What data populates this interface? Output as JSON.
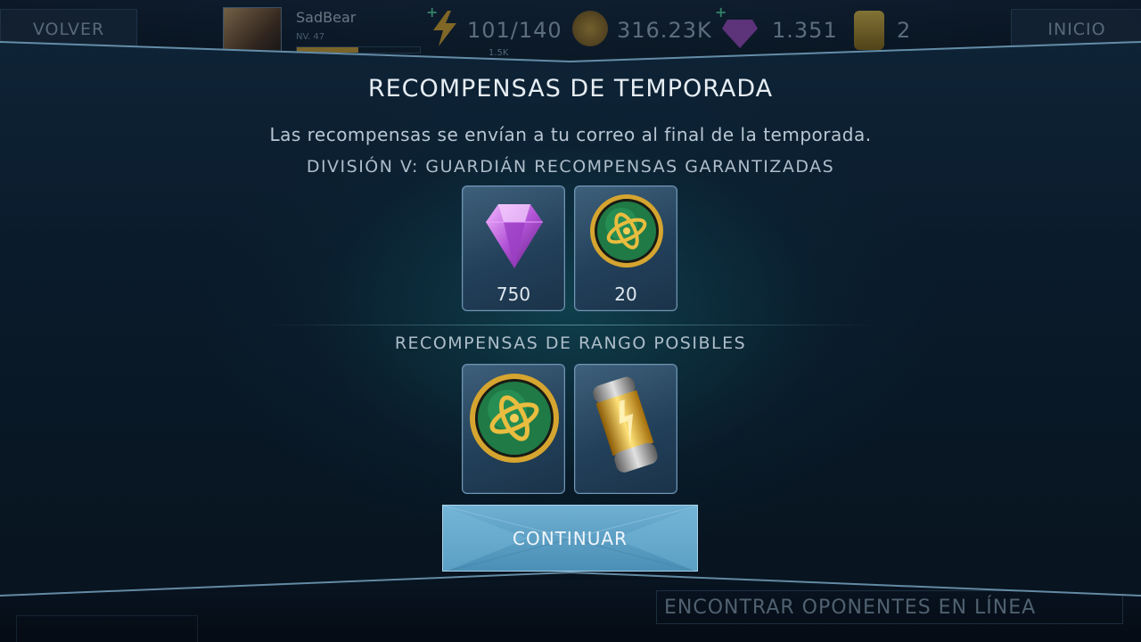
{
  "topbar": {
    "back_label": "VOLVER",
    "home_label": "INICIO",
    "player_name": "SadBear",
    "player_level": "NV. 47",
    "xp_sub": "1.5K",
    "energy": "101/140",
    "coins": "316.23K",
    "gems": "1.351",
    "cards": "2"
  },
  "modal": {
    "title": "RECOMPENSAS DE TEMPORADA",
    "subtitle": "Las recompensas se envían a tu correo al final de la temporada.",
    "guaranteed_heading": "DIVISIÓN V: GUARDIÁN RECOMPENSAS GARANTIZADAS",
    "guaranteed_rewards": [
      {
        "icon": "gem-icon",
        "quantity": "750"
      },
      {
        "icon": "arena-coin-icon",
        "quantity": "20"
      }
    ],
    "rank_heading": "RECOMPENSAS DE RANGO POSIBLES",
    "rank_rewards": [
      {
        "icon": "arena-coin-icon"
      },
      {
        "icon": "gold-card-pack-icon"
      }
    ],
    "continue_label": "CONTINUAR"
  },
  "background": {
    "find_online_label": "ENCONTRAR OPONENTES EN LÍNEA"
  },
  "colors": {
    "accent_button": "#5a9ec4",
    "panel_dark": "#0a1b2b",
    "text_light": "#e6edf3"
  }
}
